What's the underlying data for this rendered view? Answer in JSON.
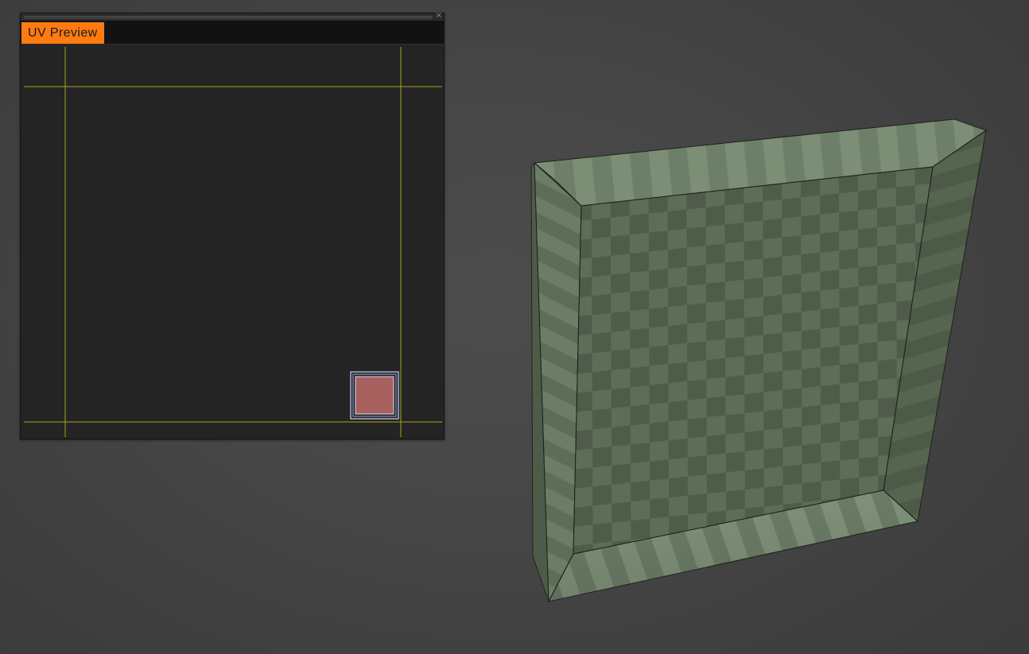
{
  "uv_preview": {
    "tab_label": "UV Preview",
    "close_glyph": "×",
    "close_icon": "close-icon"
  },
  "colors": {
    "tab_active": "#ff7b10",
    "uv_bounds_line": "#a6a51e",
    "uv_island_fill": "#a8605f",
    "uv_island_outline": "#c8d4ff",
    "model_surface_light": "#6f806b",
    "model_surface_dark": "#58684f"
  },
  "viewport": {
    "object": "3d-frame-mesh",
    "texture": "checker"
  }
}
